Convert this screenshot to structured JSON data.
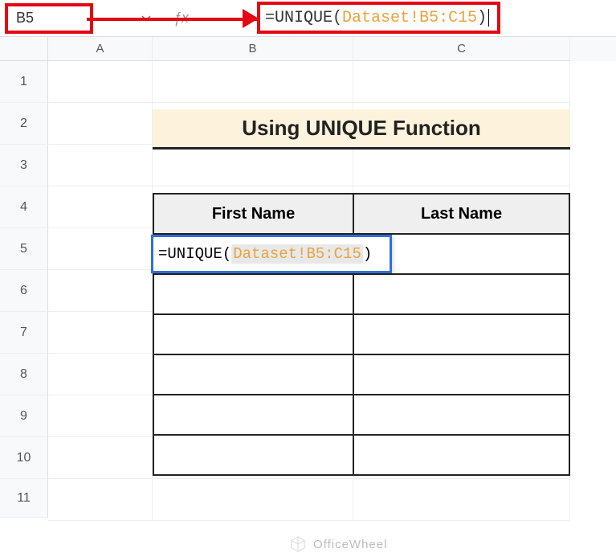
{
  "nameBox": {
    "value": "B5"
  },
  "formulaBar": {
    "prefix": "=",
    "fn": "UNIQUE",
    "open": "(",
    "ref": "Dataset!B5:C15",
    "close": ")"
  },
  "columns": {
    "A": "A",
    "B": "B",
    "C": "C"
  },
  "rows": [
    "1",
    "2",
    "3",
    "4",
    "5",
    "6",
    "7",
    "8",
    "9",
    "10",
    "11"
  ],
  "title": "Using UNIQUE Function",
  "headers": {
    "first": "First Name",
    "last": "Last Name"
  },
  "editingCell": {
    "prefix": "=",
    "fn": "UNIQUE",
    "open": "(",
    "ref": "Dataset!B5:C15",
    "close": ")"
  },
  "watermark": "OfficeWheel"
}
